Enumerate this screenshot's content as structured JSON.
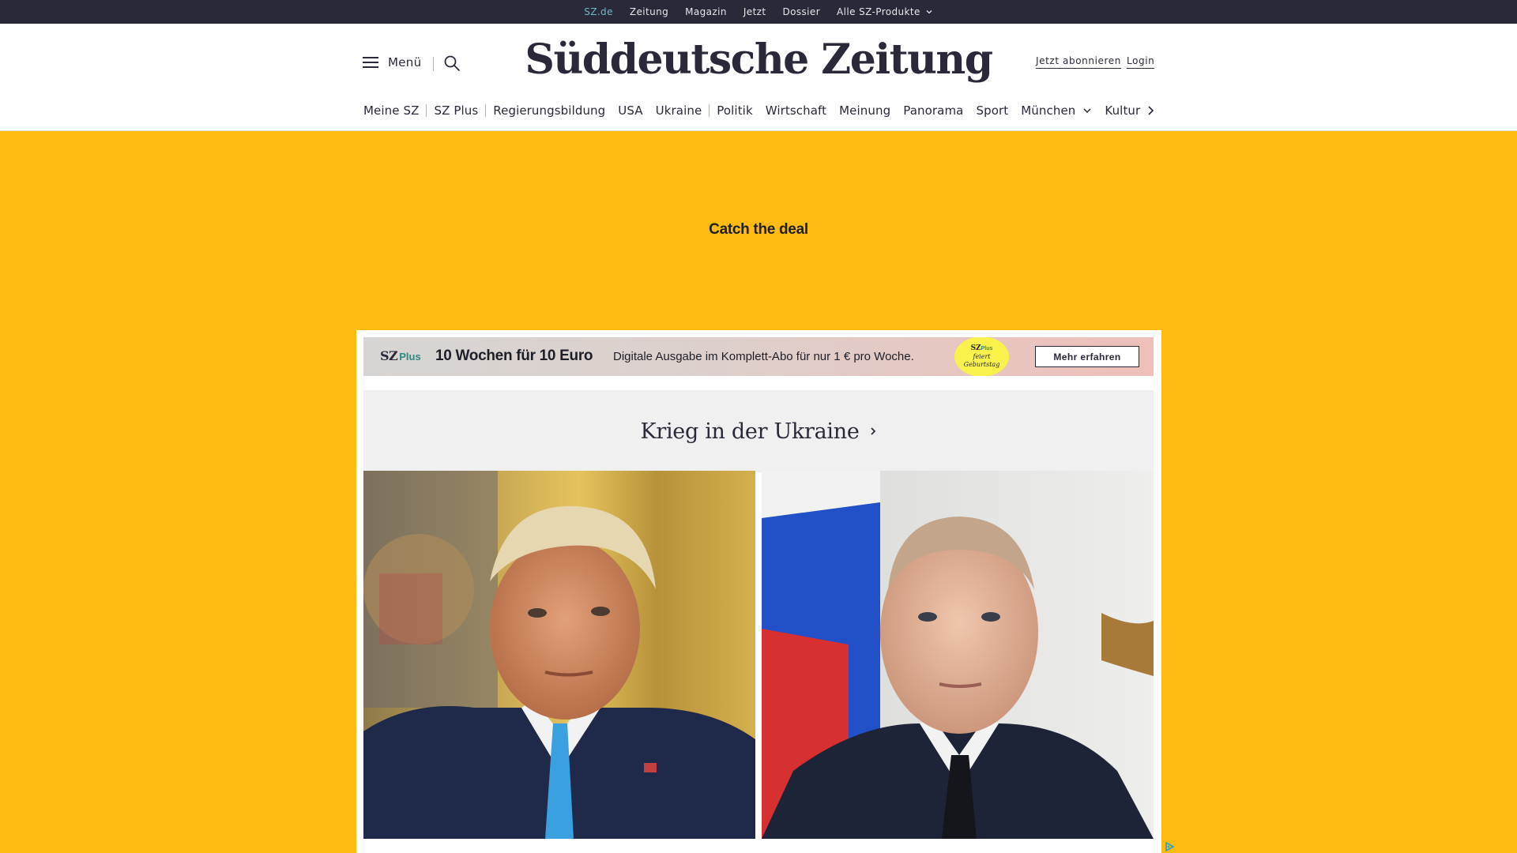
{
  "topbar": {
    "links": [
      "SZ.de",
      "Zeitung",
      "Magazin",
      "Jetzt",
      "Dossier",
      "Alle SZ-Produkte"
    ],
    "active": "SZ.de"
  },
  "header": {
    "menu_label": "Menü",
    "logo_text": "Süddeutsche Zeitung",
    "subscribe_label": "Jetzt abonnieren",
    "login_label": "Login"
  },
  "nav": {
    "items": [
      "Meine SZ",
      "SZ Plus",
      "Regierungsbildung",
      "USA",
      "Ukraine",
      "Politik",
      "Wirtschaft",
      "Meinung",
      "Panorama",
      "Sport",
      "München",
      "Kultur"
    ]
  },
  "ad": {
    "text": "Catch the deal"
  },
  "promo": {
    "logo_sz": "SZ",
    "logo_plus": "Plus",
    "headline": "10 Wochen für 10 Euro",
    "copy": "Digitale Ausgabe im Komplett-Abo für nur 1 € pro Woche.",
    "badge_line1": "feiert",
    "badge_line2": "Geburtstag",
    "cta_label": "Mehr erfahren"
  },
  "section": {
    "title": "Krieg in der Ukraine"
  },
  "colors": {
    "topbar_bg": "#29293a",
    "ad_bg": "#ffbb0f",
    "active_link": "#71b9c9",
    "plus_accent": "#2a8a86",
    "badge": "#f9f24c"
  },
  "icons": [
    "hamburger-icon",
    "search-icon",
    "chevron-down-icon",
    "chevron-right-icon",
    "adchoices-icon"
  ]
}
